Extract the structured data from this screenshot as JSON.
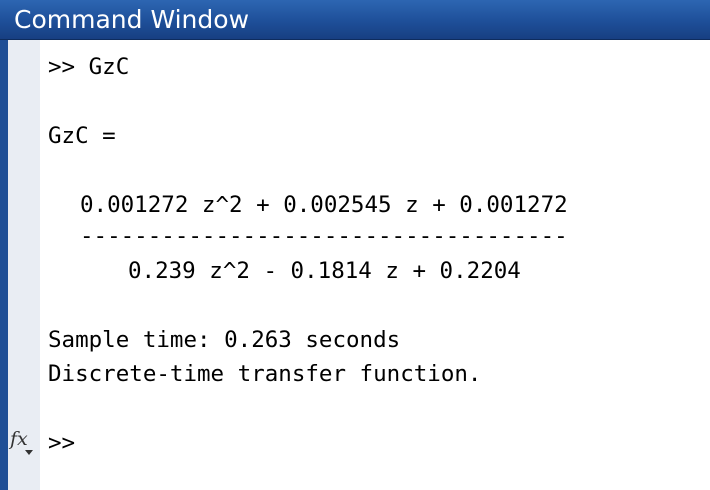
{
  "window": {
    "title": "Command Window"
  },
  "console": {
    "command_line": ">> GzC",
    "variable_line": "GzC =",
    "numerator": "0.001272 z^2 + 0.002545 z + 0.001272",
    "fraction_bar": "------------------------------------",
    "denominator": "0.239 z^2 - 0.1814 z + 0.2204",
    "sample_time_line": "Sample time: 0.263 seconds",
    "description_line": "Discrete-time transfer function.",
    "prompt": ">>"
  },
  "icons": {
    "function_browser": "fx-function-browser-icon",
    "function_browser_glyph": "fx"
  },
  "colors": {
    "titlebar": "#1e4f99",
    "title_text": "#ffffff",
    "gutter": "#e9edf3",
    "gutter_border": "#1f4f96",
    "text": "#000000",
    "background": "#ffffff"
  }
}
